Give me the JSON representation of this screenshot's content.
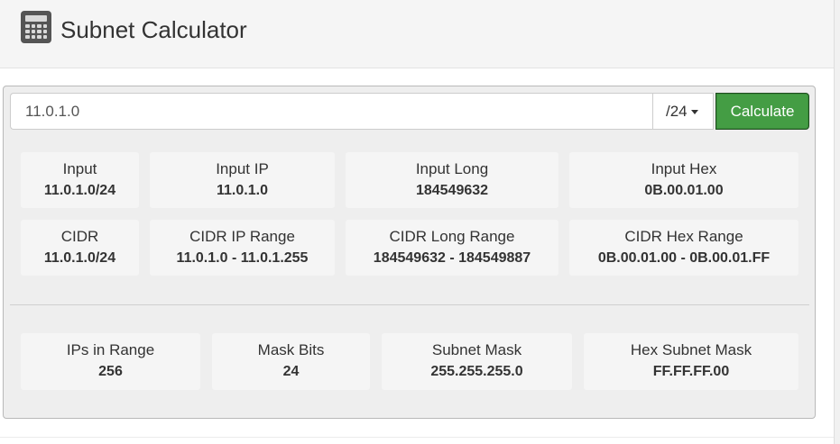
{
  "app": {
    "title": "Subnet Calculator",
    "icon": "calculator-icon"
  },
  "form": {
    "ip_value": "11.0.1.0",
    "cidr_selected": "/24",
    "calculate_label": "Calculate"
  },
  "results": {
    "input": {
      "label": "Input",
      "value": "11.0.1.0/24"
    },
    "input_ip": {
      "label": "Input IP",
      "value": "11.0.1.0"
    },
    "input_long": {
      "label": "Input Long",
      "value": "184549632"
    },
    "input_hex": {
      "label": "Input Hex",
      "value": "0B.00.01.00"
    },
    "cidr": {
      "label": "CIDR",
      "value": "11.0.1.0/24"
    },
    "cidr_ip_range": {
      "label": "CIDR IP Range",
      "value": "11.0.1.0 - 11.0.1.255"
    },
    "cidr_long_range": {
      "label": "CIDR Long Range",
      "value": "184549632 - 184549887"
    },
    "cidr_hex_range": {
      "label": "CIDR Hex Range",
      "value": "0B.00.01.00 - 0B.00.01.FF"
    },
    "ips_in_range": {
      "label": "IPs in Range",
      "value": "256"
    },
    "mask_bits": {
      "label": "Mask Bits",
      "value": "24"
    },
    "subnet_mask": {
      "label": "Subnet Mask",
      "value": "255.255.255.0"
    },
    "hex_subnet_mask": {
      "label": "Hex Subnet Mask",
      "value": "FF.FF.FF.00"
    }
  },
  "colors": {
    "button_green": "#449d44",
    "panel_bg": "#eeeeee",
    "card_bg": "#f5f5f5"
  }
}
